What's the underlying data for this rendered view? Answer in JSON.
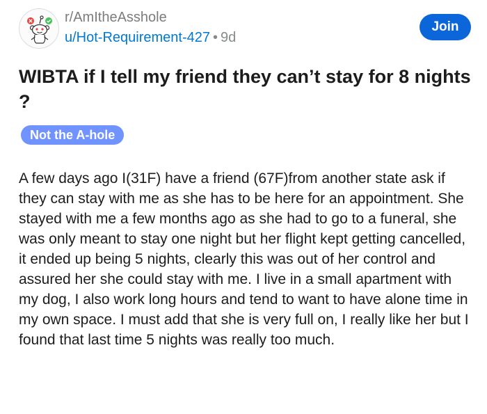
{
  "post": {
    "subreddit": "r/AmItheAsshole",
    "author": "u/Hot-Requirement-427",
    "separator": "•",
    "age": "9d",
    "join_label": "Join",
    "title": "WIBTA if I tell my friend they can’t stay for 8 nights ?",
    "flair": {
      "label": "Not the A-hole",
      "color": "#7193ff"
    },
    "body": "A few days ago I(31F) have a friend (67F)from another state ask if they can stay with me as she has to be here for an appointment. She stayed with me a few months ago as she had to go to a funeral, she was only meant to stay one night but her flight kept getting cancelled, it ended up being 5 nights, clearly this was out of her control and assured her she could stay with me. I live in a small apartment with my dog, I also work long hours and tend to want to have alone time in my own space. I must add that she is very full on, I really like her but I found that last time 5 nights was really too much."
  },
  "icons": {
    "avatar": "subreddit-snoo-icon"
  },
  "colors": {
    "accent": "#0a66d9",
    "link": "#0079d3",
    "muted": "#878a8c"
  }
}
